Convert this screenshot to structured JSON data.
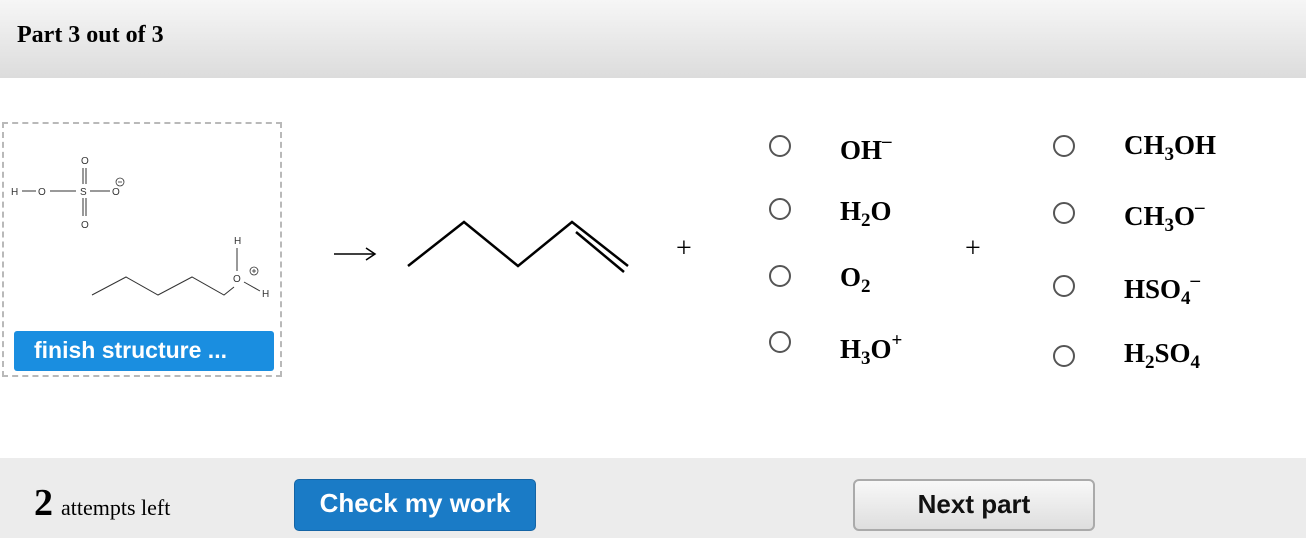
{
  "header": {
    "title": "Part 3 out of 3"
  },
  "structure": {
    "atoms": {
      "h": "H",
      "o": "O",
      "s": "S"
    },
    "finish_label": "finish structure ..."
  },
  "reaction": {
    "arrow": "⟶",
    "plus": "+"
  },
  "options_left": [
    {
      "main": "OH",
      "sub": "",
      "post": "",
      "sup": "–"
    },
    {
      "main": "H",
      "sub": "2",
      "post": "O",
      "sup": ""
    },
    {
      "main": "O",
      "sub": "2",
      "post": "",
      "sup": ""
    },
    {
      "main": "H",
      "sub": "3",
      "post": "O",
      "sup": "+"
    }
  ],
  "options_right": [
    {
      "main": "CH",
      "sub": "3",
      "post": "OH",
      "sup": ""
    },
    {
      "main": "CH",
      "sub": "3",
      "post": "O",
      "sup": "–"
    },
    {
      "main": "HSO",
      "sub": "4",
      "post": "",
      "sup": "–"
    },
    {
      "main": "H",
      "sub": "2",
      "post": "SO",
      "sup": "",
      "sub2": "4"
    }
  ],
  "footer": {
    "attempts_count": "2",
    "attempts_label": "attempts left",
    "check_label": "Check my work",
    "next_label": "Next part"
  }
}
